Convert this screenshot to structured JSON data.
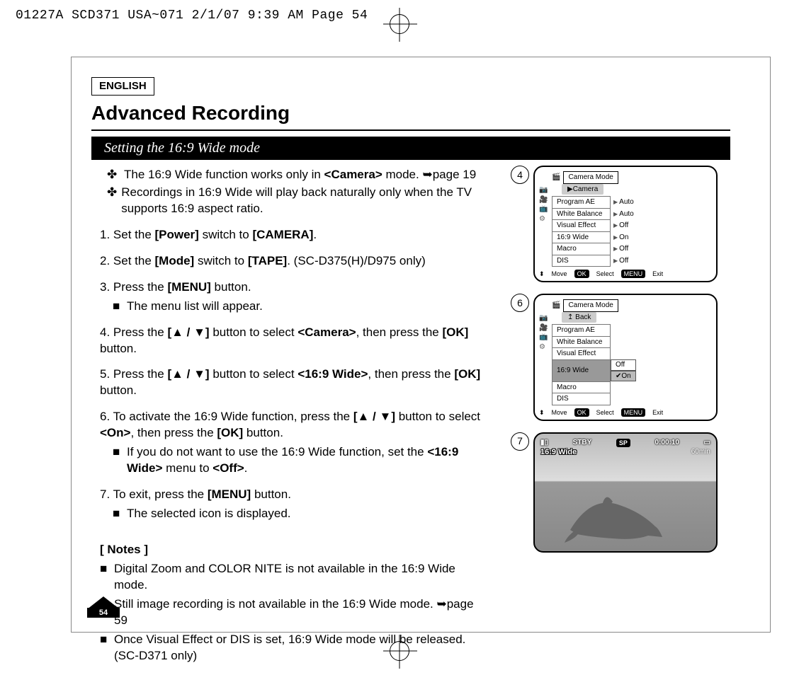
{
  "print_header": "01227A SCD371 USA~071  2/1/07 9:39 AM  Page 54",
  "language_label": "ENGLISH",
  "title": "Advanced Recording",
  "section": "Setting the 16:9 Wide mode",
  "intro": {
    "l1a": "The 16:9 Wide function works only in ",
    "l1b": "<Camera>",
    "l1c": " mode. ➥page 19",
    "l2": "Recordings in 16:9 Wide will play back naturally only when the TV supports 16:9 aspect ratio."
  },
  "steps": {
    "s1a": "1. Set the ",
    "s1b": "[Power]",
    "s1c": " switch to ",
    "s1d": "[CAMERA]",
    "s1e": ".",
    "s2a": "2. Set the ",
    "s2b": "[Mode]",
    "s2c": " switch to ",
    "s2d": "[TAPE]",
    "s2e": ". (SC-D375(H)/D975 only)",
    "s3a": "3. Press the ",
    "s3b": "[MENU]",
    "s3c": " button.",
    "s3sub": "The menu list will appear.",
    "s4a": "4. Press the ",
    "s4b": "[▲ / ▼]",
    "s4c": " button to select ",
    "s4d": "<Camera>",
    "s4e": ", then press the ",
    "s4f": "[OK]",
    "s4g": " button.",
    "s5a": "5. Press the ",
    "s5b": "[▲ / ▼]",
    "s5c": " button to select ",
    "s5d": "<16:9 Wide>",
    "s5e": ", then press the ",
    "s5f": "[OK]",
    "s5g": " button.",
    "s6a": "6. To activate the 16:9 Wide function, press the ",
    "s6b": "[▲ / ▼]",
    "s6c": " button to select ",
    "s6d": "<On>",
    "s6e": ", then press the ",
    "s6f": "[OK]",
    "s6g": " button.",
    "s6sub_a": "If you do not want to use the 16:9 Wide function, set the ",
    "s6sub_b": "<16:9 Wide>",
    "s6sub_c": " menu to ",
    "s6sub_d": "<Off>",
    "s6sub_e": ".",
    "s7a": "7. To exit, press the ",
    "s7b": "[MENU]",
    "s7c": " button.",
    "s7sub": "The selected icon is displayed."
  },
  "notes_heading": "[ Notes ]",
  "notes": {
    "n1": "Digital Zoom and COLOR NITE is not available in the 16:9 Wide mode.",
    "n2": "Still image recording is not available in the 16:9 Wide mode. ➥page 59",
    "n3": "Once Visual Effect or DIS is set, 16:9 Wide mode will be released. (SC-D371 only)"
  },
  "figures": {
    "f4": {
      "num": "4",
      "title": "Camera Mode",
      "sub": "▶Camera",
      "rows": [
        {
          "k": "Program AE",
          "v": "Auto"
        },
        {
          "k": "White Balance",
          "v": "Auto"
        },
        {
          "k": "Visual Effect",
          "v": "Off"
        },
        {
          "k": "16:9 Wide",
          "v": "On"
        },
        {
          "k": "Macro",
          "v": "Off"
        },
        {
          "k": "DIS",
          "v": "Off"
        }
      ],
      "footer": {
        "move": "Move",
        "ok": "OK",
        "select": "Select",
        "menu": "MENU",
        "exit": "Exit"
      }
    },
    "f6": {
      "num": "6",
      "title": "Camera Mode",
      "sub": "Back",
      "rows": [
        {
          "k": "Program AE"
        },
        {
          "k": "White Balance"
        },
        {
          "k": "Visual Effect"
        },
        {
          "k": "16:9 Wide",
          "opts": [
            "Off",
            "On"
          ],
          "sel": "On"
        },
        {
          "k": "Macro"
        },
        {
          "k": "DIS"
        }
      ],
      "footer": {
        "move": "Move",
        "ok": "OK",
        "select": "Select",
        "menu": "MENU",
        "exit": "Exit"
      }
    },
    "f7": {
      "num": "7",
      "stby": "STBY",
      "sp": "SP",
      "time": "0:00:10",
      "remain": "60min",
      "tag": "16:9 Wide"
    }
  },
  "page_number": "54"
}
